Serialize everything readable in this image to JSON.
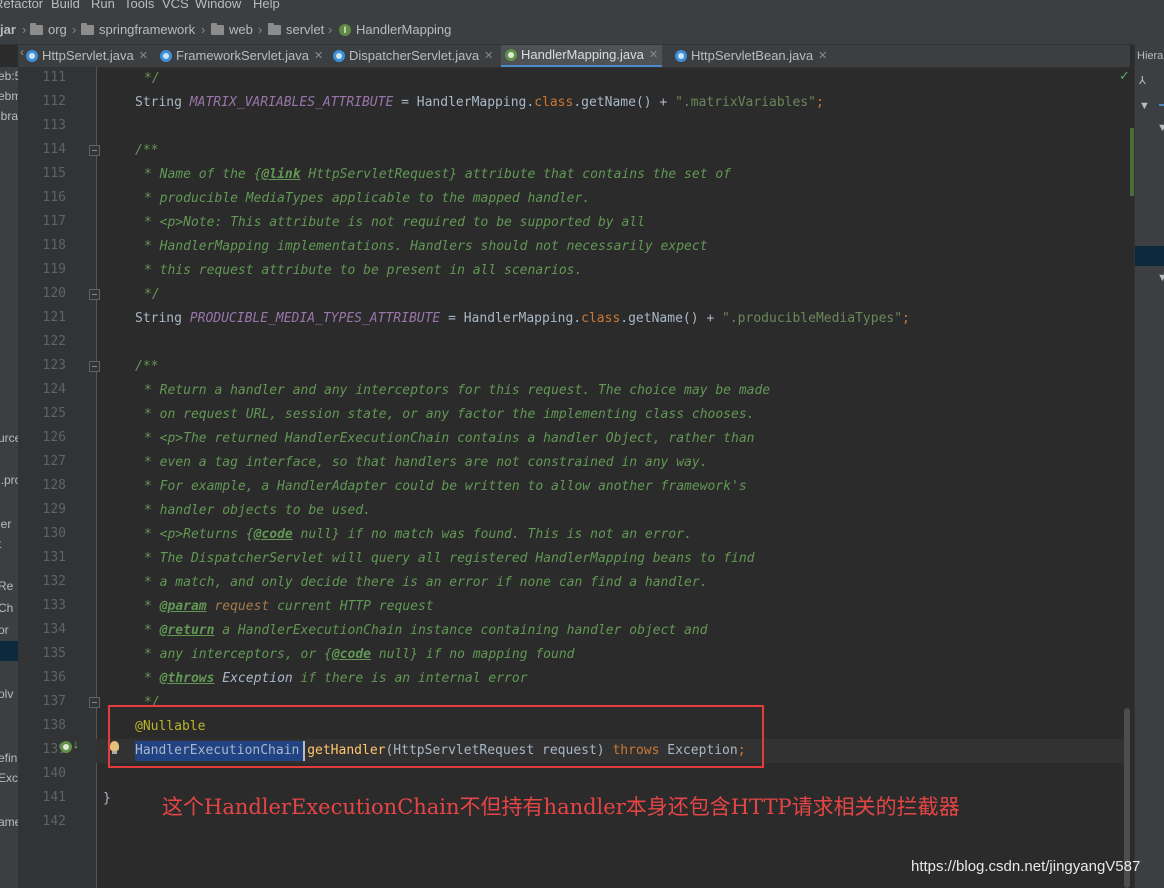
{
  "menu": [
    "Refactor",
    "Build",
    "Run",
    "Tools",
    "VCS",
    "Window",
    "Help"
  ],
  "breadcrumbs": {
    "root": "jar",
    "items": [
      "org",
      "springframework",
      "web",
      "servlet",
      "HandlerMapping"
    ]
  },
  "tabs": [
    {
      "label": "HttpServlet.java",
      "icon": "class-icon"
    },
    {
      "label": "FrameworkServlet.java",
      "icon": "class-icon"
    },
    {
      "label": "DispatcherServlet.java",
      "icon": "class-icon"
    },
    {
      "label": "HandlerMapping.java",
      "icon": "interface-icon",
      "active": true
    },
    {
      "label": "HttpServletBean.java",
      "icon": "class-icon"
    }
  ],
  "left_panel_fragments": [
    "eb:5",
    "ebm",
    "ibra",
    "urce",
    "l.pro",
    "ler",
    "t",
    "Re",
    "Ch",
    "or",
    "olv",
    "efin",
    "Exc",
    "ame"
  ],
  "right_panel": {
    "title": "Hierar"
  },
  "line_numbers": [
    "111",
    "112",
    "113",
    "114",
    "115",
    "116",
    "117",
    "118",
    "119",
    "120",
    "121",
    "122",
    "123",
    "124",
    "125",
    "126",
    "127",
    "128",
    "129",
    "130",
    "131",
    "132",
    "133",
    "134",
    "135",
    "136",
    "137",
    "138",
    "139",
    "140",
    "141",
    "142"
  ],
  "code": {
    "l111": "*/",
    "l112_type": "String",
    "l112_field": "MATRIX_VARIABLES_ATTRIBUTE",
    "l112_eq": " = HandlerMapping.",
    "l112_kw": "class",
    "l112_call": ".getName() + ",
    "l112_str": "\".matrixVariables\"",
    "l112_end": ";",
    "l114": "/**",
    "l115_a": "* Name of the {",
    "l115_tag": "@link",
    "l115_b": " HttpServletRequest} attribute that contains the set of",
    "l116": "* producible MediaTypes applicable to the mapped handler.",
    "l117_a": "* ",
    "l117_tag": "<p>",
    "l117_b": "Note: This attribute is not required to be supported by all",
    "l118": "* HandlerMapping implementations. Handlers should not necessarily expect",
    "l119": "* this request attribute to be present in all scenarios.",
    "l120": "*/",
    "l121_type": "String",
    "l121_field": "PRODUCIBLE_MEDIA_TYPES_ATTRIBUTE",
    "l121_eq": " = HandlerMapping.",
    "l121_kw": "class",
    "l121_call": ".getName() + ",
    "l121_str": "\".producibleMediaTypes\"",
    "l121_end": ";",
    "l123": "/**",
    "l124": "* Return a handler and any interceptors for this request. The choice may be made",
    "l125": "* on request URL, session state, or any factor the implementing class chooses.",
    "l126_a": "* ",
    "l126_tag": "<p>",
    "l126_b": "The returned HandlerExecutionChain contains a handler Object, rather than",
    "l127": "* even a tag interface, so that handlers are not constrained in any way.",
    "l128": "* For example, a HandlerAdapter could be written to allow another framework's",
    "l129": "* handler objects to be used.",
    "l130_a": "* ",
    "l130_tag": "<p>",
    "l130_b": "Returns {",
    "l130_tag2": "@code",
    "l130_c": " null} if no match was found. This is not an error.",
    "l131": "* The DispatcherServlet will query all registered HandlerMapping beans to find",
    "l132": "* a match, and only decide there is an error if none can find a handler.",
    "l133_a": "* ",
    "l133_tag": "@param",
    "l133_param": "request",
    "l133_b": " current HTTP request",
    "l134_a": "* ",
    "l134_tag": "@return",
    "l134_b": " a HandlerExecutionChain instance containing handler object and",
    "l135_a": "* any interceptors, or {",
    "l135_tag": "@code",
    "l135_b": " null} if no mapping found",
    "l136_a": "* ",
    "l136_tag": "@throws",
    "l136_b": " Exception",
    "l136_c": " if there is an internal error",
    "l137": "*/",
    "l138": "@Nullable",
    "l139_type": "HandlerExecutionChain",
    "l139_sp": " ",
    "l139_method": "getHandler",
    "l139_params": "(HttpServletRequest request) ",
    "l139_throws": "throws",
    "l139_ex": " Exception",
    "l139_end": ";",
    "l141": "}"
  },
  "annotation_text": "这个HandlerExecutionChain不但持有handler本身还包含HTTP请求相关的拦截器",
  "watermark": "https://blog.csdn.net/jingyangV587",
  "colors": {
    "annotation": "#e64545",
    "highlight_box": "#e43b3b",
    "selection": "#214283"
  }
}
